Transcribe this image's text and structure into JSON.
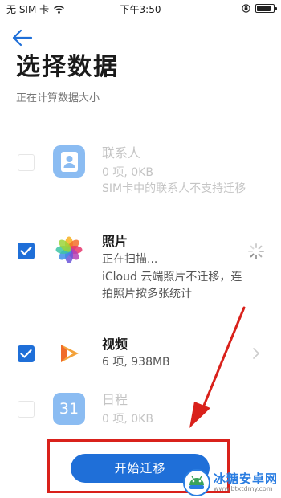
{
  "status_bar": {
    "carrier": "无 SIM 卡",
    "time": "下午3:50"
  },
  "header": {
    "title": "选择数据",
    "subtitle": "正在计算数据大小"
  },
  "items": [
    {
      "title": "联系人",
      "detail": "0 项, 0KB",
      "note": "SIM卡中的联系人不支持迁移",
      "checked": false,
      "disabled": true,
      "icon": "contacts-icon"
    },
    {
      "title": "照片",
      "detail": "正在扫描...",
      "note": "iCloud 云端照片不迁移，连拍照片按多张统计",
      "checked": true,
      "disabled": false,
      "icon": "photos-icon"
    },
    {
      "title": "视频",
      "detail": "6 项, 938MB",
      "checked": true,
      "disabled": false,
      "icon": "video-icon"
    },
    {
      "title": "日程",
      "detail": "0 项, 0KB",
      "checked": false,
      "disabled": true,
      "icon": "calendar-icon",
      "icon_text": "31"
    }
  ],
  "actions": {
    "start_label": "开始迁移"
  },
  "watermark": {
    "text": "冰糖安卓网",
    "url": "www.btxtdmy.com"
  },
  "colors": {
    "accent": "#1f6fd8",
    "annotation": "#d9211b"
  }
}
